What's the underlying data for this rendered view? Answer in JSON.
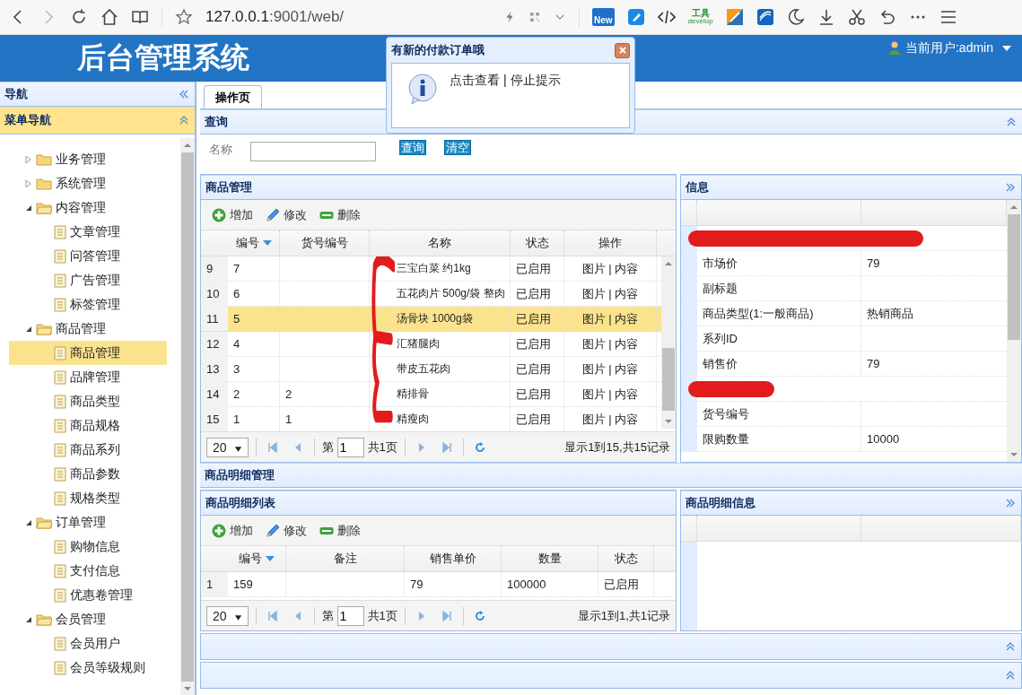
{
  "browser": {
    "url_host": "127.0.0.1",
    "url_rest": ":9001/web/",
    "new_badge": "New",
    "tools_label": "工具",
    "tools_sublabel": "develop"
  },
  "header": {
    "title": "后台管理系统",
    "user": "当前用户:admin"
  },
  "notification": {
    "title": "有新的付款订单哦",
    "view_link": "点击查看",
    "separator": "|",
    "stop_link": "停止提示"
  },
  "nav": {
    "title": "导航",
    "section": "菜单导航",
    "tree": [
      {
        "label": "业务管理",
        "expanded": false
      },
      {
        "label": "系统管理",
        "expanded": false
      },
      {
        "label": "内容管理",
        "expanded": true,
        "children": [
          {
            "label": "文章管理",
            "selected": false
          },
          {
            "label": "问答管理",
            "selected": false
          },
          {
            "label": "广告管理",
            "selected": false
          },
          {
            "label": "标签管理",
            "selected": false
          }
        ]
      },
      {
        "label": "商品管理",
        "expanded": true,
        "children": [
          {
            "label": "商品管理",
            "selected": true
          },
          {
            "label": "品牌管理",
            "selected": false
          },
          {
            "label": "商品类型",
            "selected": false
          },
          {
            "label": "商品规格",
            "selected": false
          },
          {
            "label": "商品系列",
            "selected": false
          },
          {
            "label": "商品参数",
            "selected": false
          },
          {
            "label": "规格类型",
            "selected": false
          }
        ]
      },
      {
        "label": "订单管理",
        "expanded": true,
        "children": [
          {
            "label": "购物信息",
            "selected": false
          },
          {
            "label": "支付信息",
            "selected": false
          },
          {
            "label": "优惠卷管理",
            "selected": false
          }
        ]
      },
      {
        "label": "会员管理",
        "expanded": true,
        "children": [
          {
            "label": "会员用户",
            "selected": false
          },
          {
            "label": "会员等级规则",
            "selected": false
          }
        ]
      }
    ]
  },
  "tabs": [
    {
      "label": "操作页",
      "selected": true
    }
  ],
  "query": {
    "title": "查询",
    "field_label": "名称",
    "buttons": [
      "查询",
      "清空"
    ]
  },
  "products": {
    "title": "商品管理",
    "toolbar": [
      {
        "kind": "add",
        "label": "增加"
      },
      {
        "kind": "edit",
        "label": "修改"
      },
      {
        "kind": "delete",
        "label": "删除"
      }
    ],
    "columns": [
      {
        "label": "编号",
        "sorted": true
      },
      {
        "label": "货号编号",
        "sorted": false
      },
      {
        "label": "名称",
        "sorted": false
      },
      {
        "label": "状态",
        "sorted": false
      },
      {
        "label": "操作",
        "sorted": false
      }
    ],
    "rows": [
      {
        "index": "9",
        "id": "7",
        "sku": "",
        "name": "三宝白菜 约1kg",
        "status": "已启用",
        "actions": "图片 | 内容",
        "selected": false
      },
      {
        "index": "10",
        "id": "6",
        "sku": "",
        "name": "五花肉片 500g/袋 整肉",
        "status": "已启用",
        "actions": "图片 | 内容",
        "selected": false
      },
      {
        "index": "11",
        "id": "5",
        "sku": "",
        "name": "汤骨块 1000g袋",
        "status": "已启用",
        "actions": "图片 | 内容",
        "selected": true
      },
      {
        "index": "12",
        "id": "4",
        "sku": "",
        "name": "汇猪腿肉",
        "status": "已启用",
        "actions": "图片 | 内容",
        "selected": false
      },
      {
        "index": "13",
        "id": "3",
        "sku": "",
        "name": "带皮五花肉",
        "status": "已启用",
        "actions": "图片 | 内容",
        "selected": false
      },
      {
        "index": "14",
        "id": "2",
        "sku": "2",
        "name": "精排骨",
        "status": "已启用",
        "actions": "图片 | 内容",
        "selected": false
      },
      {
        "index": "15",
        "id": "1",
        "sku": "1",
        "name": "精瘦肉",
        "status": "已启用",
        "actions": "图片 | 内容",
        "selected": false
      }
    ],
    "pager": {
      "page_size": "20",
      "page_prefix": "第",
      "page": "1",
      "page_total": "共1页",
      "summary": "显示1到15,共15记录"
    }
  },
  "info": {
    "title": "信息",
    "rows": [
      {
        "key": "",
        "value": "",
        "redacted": true
      },
      {
        "key": "市场价",
        "value": "79",
        "redacted": false
      },
      {
        "key": "副标题",
        "value": "",
        "redacted": false
      },
      {
        "key": "商品类型(1:一般商品)",
        "value": "热销商品",
        "redacted": false
      },
      {
        "key": "系列ID",
        "value": "",
        "redacted": false
      },
      {
        "key": "销售价",
        "value": "79",
        "redacted": false
      },
      {
        "key": "",
        "value": "",
        "redacted": true
      },
      {
        "key": "货号编号",
        "value": "",
        "redacted": false
      },
      {
        "key": "限购数量",
        "value": "10000",
        "redacted": false
      }
    ]
  },
  "detail": {
    "title": "商品明细管理",
    "list_title": "商品明细列表",
    "toolbar": [
      {
        "kind": "add",
        "label": "增加"
      },
      {
        "kind": "edit",
        "label": "修改"
      },
      {
        "kind": "delete",
        "label": "删除"
      }
    ],
    "columns": [
      {
        "label": "编号",
        "sorted": true
      },
      {
        "label": "备注",
        "sorted": false
      },
      {
        "label": "销售单价",
        "sorted": false
      },
      {
        "label": "数量",
        "sorted": false
      },
      {
        "label": "状态",
        "sorted": false
      }
    ],
    "rows": [
      {
        "index": "1",
        "cells": [
          "159",
          "",
          "79",
          "100000",
          "已启用"
        ]
      }
    ],
    "pager": {
      "page_size": "20",
      "page_prefix": "第",
      "page": "1",
      "page_total": "共1页",
      "summary": "显示1到1,共1记录"
    },
    "info_title": "商品明细信息"
  }
}
